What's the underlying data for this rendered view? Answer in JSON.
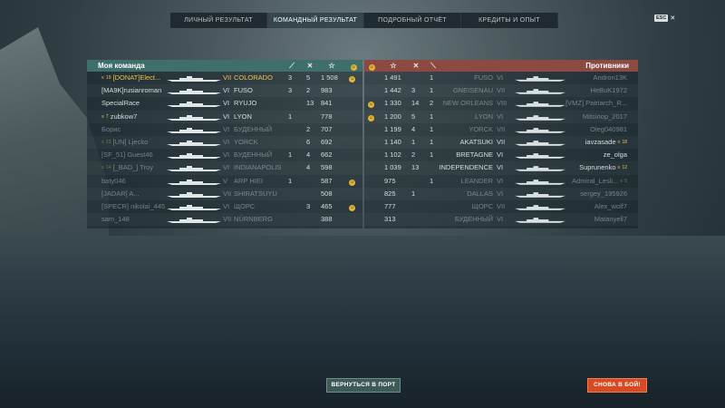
{
  "tabs": [
    {
      "label": "ЛИЧНЫЙ РЕЗУЛЬТАТ",
      "active": false
    },
    {
      "label": "КОМАНДНЫЙ РЕЗУЛЬТАТ",
      "active": true
    },
    {
      "label": "ПОДРОБНЫЙ ОТЧЁТ",
      "active": false
    },
    {
      "label": "КРЕДИТЫ И ОПЫТ",
      "active": false
    }
  ],
  "esc": {
    "key": "ESC",
    "icon": "close-icon"
  },
  "left": {
    "title": "Моя команда",
    "columns": [
      "torpedo-icon",
      "kills-icon",
      "star-icon",
      "smile-icon"
    ],
    "rows": [
      {
        "rank": "19",
        "name": "[DONAT]Elect...",
        "tier": "VII",
        "ship": "COLORADO",
        "torp": "3",
        "kills": "5",
        "exp": "1 508",
        "smile": true,
        "gold": true,
        "dim": false
      },
      {
        "rank": "",
        "name": "[MA9K]rusianroman",
        "tier": "VI",
        "ship": "FUSO",
        "torp": "3",
        "kills": "2",
        "exp": "983",
        "smile": false,
        "gold": false,
        "dim": false
      },
      {
        "rank": "",
        "name": "SpecialRace",
        "tier": "VI",
        "ship": "RYUJO",
        "torp": "",
        "kills": "13",
        "exp": "841",
        "smile": false,
        "gold": false,
        "dim": false
      },
      {
        "rank": "7",
        "name": "zubkow7",
        "tier": "VI",
        "ship": "LYON",
        "torp": "1",
        "kills": "",
        "exp": "778",
        "smile": false,
        "gold": false,
        "dim": false
      },
      {
        "rank": "",
        "name": "Борис",
        "tier": "VI",
        "ship": "БУДЕННЫЙ",
        "torp": "",
        "kills": "2",
        "exp": "707",
        "smile": false,
        "gold": false,
        "dim": true
      },
      {
        "rank": "23",
        "name": "[UN] Ljecko",
        "tier": "VI",
        "ship": "YORCK",
        "torp": "",
        "kills": "6",
        "exp": "692",
        "smile": false,
        "gold": false,
        "dim": true
      },
      {
        "rank": "",
        "name": "[SF_51] Guest46",
        "tier": "VI",
        "ship": "БУДЕННЫЙ",
        "torp": "1",
        "kills": "4",
        "exp": "662",
        "smile": false,
        "gold": false,
        "dim": true
      },
      {
        "rank": "14",
        "name": "[_BAD_] Troy",
        "tier": "VI",
        "ship": "INDIANAPOLIS",
        "torp": "",
        "kills": "4",
        "exp": "598",
        "smile": false,
        "gold": false,
        "dim": true
      },
      {
        "rank": "",
        "name": "baty046",
        "tier": "V",
        "ship": "ARP HIEI",
        "torp": "1",
        "kills": "",
        "exp": "587",
        "smile": true,
        "gold": false,
        "dim": true
      },
      {
        "rank": "",
        "name": "[JADAR] A...",
        "tier": "VII",
        "ship": "SHIRATSUYU",
        "torp": "",
        "kills": "",
        "exp": "508",
        "smile": false,
        "gold": false,
        "dim": true
      },
      {
        "rank": "",
        "name": "[SPECR] nikolai_445",
        "tier": "VI",
        "ship": "ЩОРС",
        "torp": "",
        "kills": "3",
        "exp": "465",
        "smile": true,
        "gold": false,
        "dim": true
      },
      {
        "rank": "",
        "name": "sam_148",
        "tier": "VII",
        "ship": "NÜRNBERG",
        "torp": "",
        "kills": "",
        "exp": "388",
        "smile": false,
        "gold": false,
        "dim": true
      }
    ]
  },
  "right": {
    "title": "Противники",
    "columns": [
      "smile-icon",
      "star-icon",
      "kills-icon",
      "torpedo-icon"
    ],
    "rows": [
      {
        "smile": false,
        "exp": "1 491",
        "kills": "",
        "torp": "1",
        "ship": "FUSO",
        "tier": "VI",
        "name": "Andron13K",
        "badge": "",
        "dim": true
      },
      {
        "smile": false,
        "exp": "1 442",
        "kills": "3",
        "torp": "1",
        "ship": "GNEISENAU",
        "tier": "VII",
        "name": "HeBuK1972",
        "badge": "",
        "dim": true
      },
      {
        "smile": true,
        "exp": "1 330",
        "kills": "14",
        "torp": "2",
        "ship": "NEW ORLEANS",
        "tier": "VIII",
        "name": "[VMZ] Patriarch_R...",
        "badge": "",
        "dim": true
      },
      {
        "smile": true,
        "exp": "1 200",
        "kills": "5",
        "torp": "1",
        "ship": "LYON",
        "tier": "VI",
        "name": "Mitsiлор_2017",
        "badge": "",
        "dim": true
      },
      {
        "smile": false,
        "exp": "1 199",
        "kills": "4",
        "torp": "1",
        "ship": "YORCK",
        "tier": "VII",
        "name": "Oleg040981",
        "badge": "",
        "dim": true
      },
      {
        "smile": false,
        "exp": "1 140",
        "kills": "1",
        "torp": "1",
        "ship": "AKATSUKI",
        "tier": "VII",
        "name": "iavzasade",
        "badge": "18",
        "dim": false
      },
      {
        "smile": false,
        "exp": "1 102",
        "kills": "2",
        "torp": "1",
        "ship": "BRETAGNE",
        "tier": "VI",
        "name": "ze_olga",
        "badge": "",
        "dim": false
      },
      {
        "smile": false,
        "exp": "1 039",
        "kills": "13",
        "torp": "",
        "ship": "INDEPENDENCE",
        "tier": "VI",
        "name": "Suprunenko",
        "badge": "12",
        "dim": false
      },
      {
        "smile": false,
        "exp": "975",
        "kills": "",
        "torp": "1",
        "ship": "LEANDER",
        "tier": "VI",
        "name": "Admiral_Lesli...",
        "badge": "5",
        "dim": true
      },
      {
        "smile": false,
        "exp": "825",
        "kills": "1",
        "torp": "",
        "ship": "DALLAS",
        "tier": "VI",
        "name": "sergey_195926",
        "badge": "",
        "dim": true
      },
      {
        "smile": false,
        "exp": "777",
        "kills": "",
        "torp": "",
        "ship": "ЩОРС",
        "tier": "VII",
        "name": "Alex_wolf7",
        "badge": "",
        "dim": true
      },
      {
        "smile": false,
        "exp": "313",
        "kills": "",
        "torp": "",
        "ship": "БУДЕННЫЙ",
        "tier": "VI",
        "name": "Matanyell7",
        "badge": "",
        "dim": true
      }
    ]
  },
  "buttons": {
    "port": "ВЕРНУТЬСЯ В ПОРТ",
    "again": "СНОВА В БОЙ!"
  }
}
